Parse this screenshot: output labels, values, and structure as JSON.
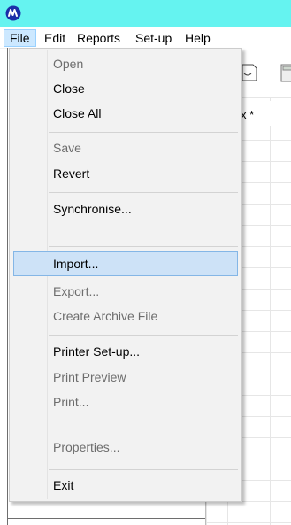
{
  "menubar": {
    "items": [
      {
        "label": "File"
      },
      {
        "label": "Edit"
      },
      {
        "label": "Reports"
      },
      {
        "label": "Set-up"
      },
      {
        "label": "Help"
      }
    ]
  },
  "background": {
    "grid_header": "x *"
  },
  "file_menu": {
    "items": [
      {
        "label": "Open",
        "enabled": false
      },
      {
        "label": "Close",
        "enabled": true
      },
      {
        "label": "Close All",
        "enabled": true
      },
      {
        "label": "Save",
        "enabled": false
      },
      {
        "label": "Revert",
        "enabled": true
      },
      {
        "label": "Synchronise...",
        "enabled": true
      },
      {
        "label": "Import...",
        "enabled": true,
        "highlighted": true
      },
      {
        "label": "Export...",
        "enabled": false
      },
      {
        "label": "Create Archive File",
        "enabled": false
      },
      {
        "label": "Printer Set-up...",
        "enabled": true
      },
      {
        "label": "Print Preview",
        "enabled": false
      },
      {
        "label": "Print...",
        "enabled": false
      },
      {
        "label": "Properties...",
        "enabled": false
      },
      {
        "label": "Exit",
        "enabled": true
      }
    ]
  },
  "colors": {
    "titlebar": "#65f3f0",
    "menu_bg": "#f2f2f2",
    "highlight": "#cde2f7",
    "disabled_text": "#6d6d6d"
  }
}
